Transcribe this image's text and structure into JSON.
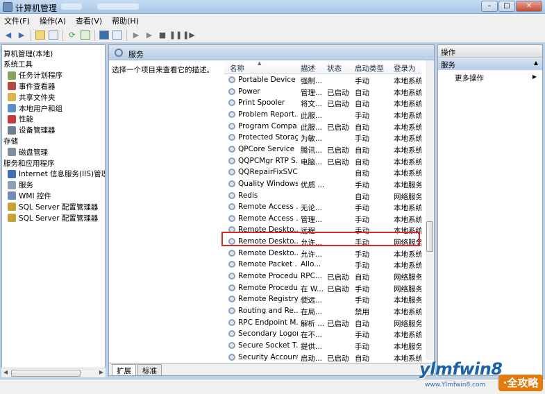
{
  "window": {
    "title": "计算机管理"
  },
  "menu": [
    "文件(F)",
    "操作(A)",
    "查看(V)",
    "帮助(H)"
  ],
  "tree": [
    {
      "label": "算机管理(本地)",
      "indent": 0,
      "color": "#6f8fb8"
    },
    {
      "label": "系统工具",
      "indent": 0,
      "color": "#6f8fb8"
    },
    {
      "label": "任务计划程序",
      "indent": 1,
      "color": "#8ba35c"
    },
    {
      "label": "事件查看器",
      "indent": 1,
      "color": "#b54b3e"
    },
    {
      "label": "共享文件夹",
      "indent": 1,
      "color": "#d9b54a"
    },
    {
      "label": "本地用户和组",
      "indent": 1,
      "color": "#5b8fc7"
    },
    {
      "label": "性能",
      "indent": 1,
      "color": "#c43a3a"
    },
    {
      "label": "设备管理器",
      "indent": 1,
      "color": "#6e7f92"
    },
    {
      "label": "存储",
      "indent": 0,
      "color": "#6f8fb8"
    },
    {
      "label": "磁盘管理",
      "indent": 1,
      "color": "#7f8fa0"
    },
    {
      "label": "服务和应用程序",
      "indent": 0,
      "color": "#6f8fb8"
    },
    {
      "label": "Internet 信息服务(IIS)管理器",
      "indent": 1,
      "color": "#3f6fb0"
    },
    {
      "label": "服务",
      "indent": 1,
      "color": "#8aa0bb"
    },
    {
      "label": "WMI 控件",
      "indent": 1,
      "color": "#6f8fb8"
    },
    {
      "label": "SQL Server 配置管理器",
      "indent": 1,
      "color": "#c9a13a"
    },
    {
      "label": "SQL Server 配置管理器",
      "indent": 1,
      "color": "#c9a13a"
    }
  ],
  "center": {
    "header": "服务",
    "description_hint": "选择一个项目来查看它的描述。",
    "columns": {
      "name": "名称",
      "desc": "描述",
      "status": "状态",
      "startup": "启动类型",
      "logon": "登录为"
    },
    "tabs": [
      "扩展",
      "标准"
    ]
  },
  "services": [
    {
      "name": "Portable Device ...",
      "desc": "强制...",
      "status": "",
      "startup": "手动",
      "logon": "本地系统"
    },
    {
      "name": "Power",
      "desc": "管理...",
      "status": "已启动",
      "startup": "自动",
      "logon": "本地系统"
    },
    {
      "name": "Print Spooler",
      "desc": "将文...",
      "status": "已启动",
      "startup": "自动",
      "logon": "本地系统"
    },
    {
      "name": "Problem Report...",
      "desc": "此服...",
      "status": "",
      "startup": "手动",
      "logon": "本地系统"
    },
    {
      "name": "Program Compa...",
      "desc": "此服...",
      "status": "已启动",
      "startup": "自动",
      "logon": "本地系统"
    },
    {
      "name": "Protected Storage",
      "desc": "为敏...",
      "status": "",
      "startup": "手动",
      "logon": "本地系统"
    },
    {
      "name": "QPCore Service",
      "desc": "腾讯...",
      "status": "已启动",
      "startup": "自动",
      "logon": "本地系统"
    },
    {
      "name": "QQPCMgr RTP S...",
      "desc": "电脑...",
      "status": "已启动",
      "startup": "自动",
      "logon": "本地系统"
    },
    {
      "name": "QQRepairFixSVC",
      "desc": "",
      "status": "",
      "startup": "自动",
      "logon": "本地系统"
    },
    {
      "name": "Quality Windows...",
      "desc": "优质 ...",
      "status": "",
      "startup": "手动",
      "logon": "本地服务"
    },
    {
      "name": "Redis",
      "desc": "",
      "status": "",
      "startup": "自动",
      "logon": "网络服务"
    },
    {
      "name": "Remote Access ...",
      "desc": "无论...",
      "status": "",
      "startup": "手动",
      "logon": "本地系统"
    },
    {
      "name": "Remote Access ...",
      "desc": "管理...",
      "status": "",
      "startup": "手动",
      "logon": "本地系统"
    },
    {
      "name": "Remote Deskto...",
      "desc": "远程...",
      "status": "",
      "startup": "手动",
      "logon": "本地系统"
    },
    {
      "name": "Remote Deskto...",
      "desc": "允许...",
      "status": "",
      "startup": "手动",
      "logon": "网络服务"
    },
    {
      "name": "Remote Deskto...",
      "desc": "允许...",
      "status": "",
      "startup": "手动",
      "logon": "本地系统"
    },
    {
      "name": "Remote Packet ...",
      "desc": "Allo...",
      "status": "",
      "startup": "手动",
      "logon": "本地系统"
    },
    {
      "name": "Remote Procedu...",
      "desc": "RPC...",
      "status": "已启动",
      "startup": "自动",
      "logon": "网络服务"
    },
    {
      "name": "Remote Procedu...",
      "desc": "在 W...",
      "status": "已启动",
      "startup": "手动",
      "logon": "网络服务"
    },
    {
      "name": "Remote Registry",
      "desc": "使远...",
      "status": "",
      "startup": "手动",
      "logon": "本地服务"
    },
    {
      "name": "Routing and Re...",
      "desc": "在局...",
      "status": "",
      "startup": "禁用",
      "logon": "本地系统"
    },
    {
      "name": "RPC Endpoint M...",
      "desc": "解析 ...",
      "status": "已启动",
      "startup": "自动",
      "logon": "网络服务"
    },
    {
      "name": "Secondary Logon",
      "desc": "在不...",
      "status": "",
      "startup": "手动",
      "logon": "本地系统"
    },
    {
      "name": "Secure Socket T...",
      "desc": "提供...",
      "status": "",
      "startup": "手动",
      "logon": "本地服务"
    },
    {
      "name": "Security Account...",
      "desc": "启动...",
      "status": "已启动",
      "startup": "自动",
      "logon": "本地系统"
    }
  ],
  "actions": {
    "header": "操作",
    "section": "服务",
    "more": "更多操作"
  },
  "watermark": {
    "main": "ylmfwin8",
    "badge": "·全攻略",
    "small": "www.Ylmfwin8.com"
  }
}
